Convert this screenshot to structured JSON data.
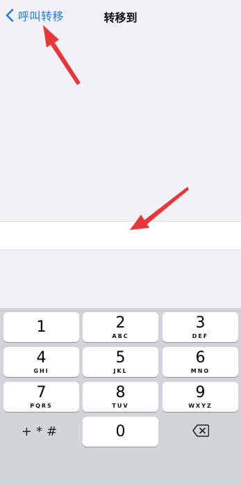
{
  "nav": {
    "back_label": "呼叫转移",
    "title": "转移到"
  },
  "input": {
    "value": "",
    "placeholder": ""
  },
  "keypad": {
    "keys": [
      {
        "digit": "1",
        "letters": ""
      },
      {
        "digit": "2",
        "letters": "ABC"
      },
      {
        "digit": "3",
        "letters": "DEF"
      },
      {
        "digit": "4",
        "letters": "GHI"
      },
      {
        "digit": "5",
        "letters": "JKL"
      },
      {
        "digit": "6",
        "letters": "MNO"
      },
      {
        "digit": "7",
        "letters": "PQRS"
      },
      {
        "digit": "8",
        "letters": "TUV"
      },
      {
        "digit": "9",
        "letters": "WXYZ"
      },
      {
        "digit": "0",
        "letters": ""
      }
    ],
    "symbols_label": "+*#"
  },
  "colors": {
    "accent": "#1a7cf5",
    "annotation_arrow": "#e8373a",
    "keyboard_bg": "#d2d4da",
    "page_bg": "#f2f1f6"
  },
  "icons": {
    "back": "chevron-left-icon",
    "delete": "backspace-icon"
  }
}
